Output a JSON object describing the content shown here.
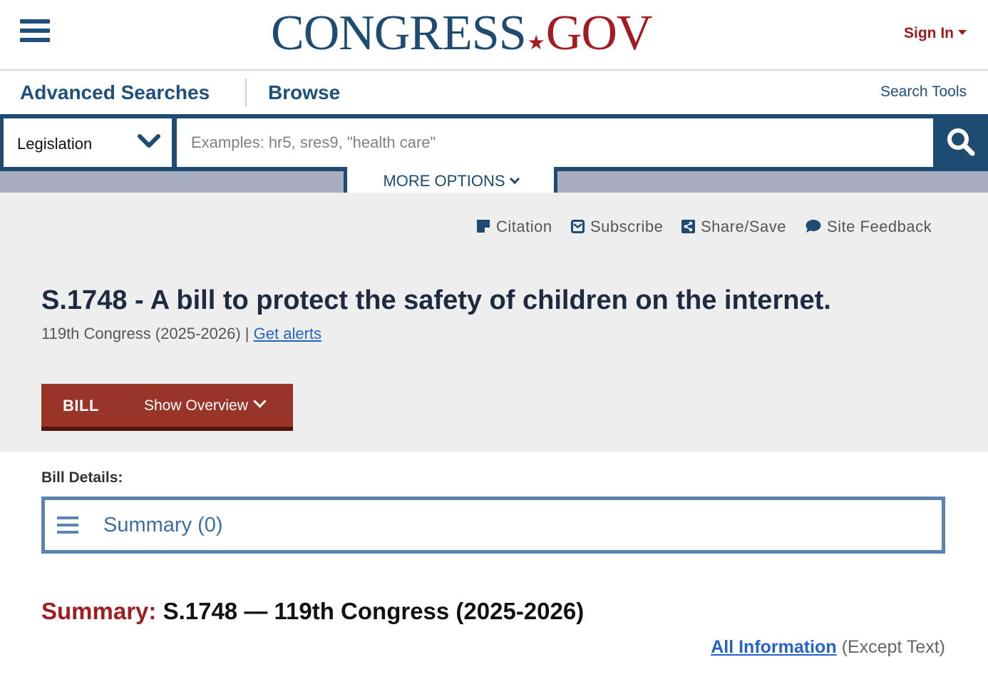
{
  "header": {
    "logo_main": "CONGRESS",
    "logo_dot": "★",
    "logo_suffix": "GOV",
    "sign_in": "Sign In"
  },
  "nav": {
    "advanced_searches": "Advanced Searches",
    "browse": "Browse",
    "search_tools": "Search Tools"
  },
  "search": {
    "collection": "Legislation",
    "placeholder": "Examples: hr5, sres9, \"health care\"",
    "more_options": "MORE OPTIONS"
  },
  "tools": {
    "citation": "Citation",
    "subscribe": "Subscribe",
    "share_save": "Share/Save",
    "site_feedback": "Site Feedback"
  },
  "bill": {
    "title": "S.1748 - A bill to protect the safety of children on the internet.",
    "congress": "119th Congress (2025-2026)",
    "separator": "|",
    "get_alerts": "Get alerts",
    "tab_label": "BILL",
    "show_overview": "Show Overview"
  },
  "details": {
    "label": "Bill Details:",
    "summary_item": "Summary (0)"
  },
  "summary": {
    "label": "Summary:",
    "heading": "S.1748 — 119th Congress (2025-2026)",
    "all_information": "All Information",
    "except_text": "(Except Text)"
  },
  "colors": {
    "navy": "#1d4b72",
    "brand_red": "#a11d21",
    "bill_tab": "#993429",
    "link_blue": "#2563c6"
  }
}
